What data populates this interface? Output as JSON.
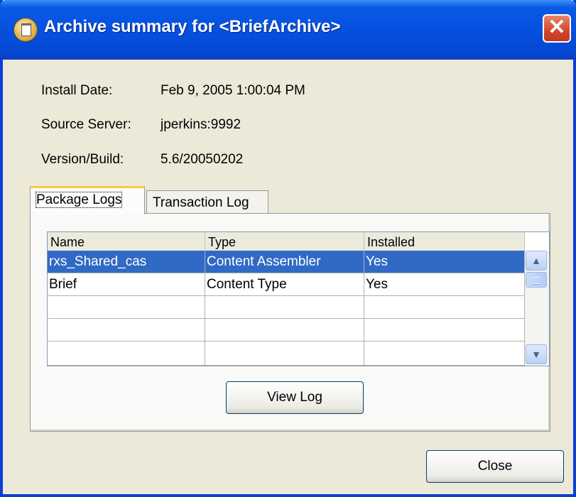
{
  "window": {
    "title": "Archive summary for <BriefArchive>"
  },
  "summary": {
    "install_date_label": "Install Date:",
    "install_date_value": "Feb 9, 2005 1:00:04 PM",
    "source_server_label": "Source Server:",
    "source_server_value": "jperkins:9992",
    "version_label": "Version/Build:",
    "version_value": "5.6/20050202"
  },
  "tabs": [
    {
      "label": "Package Logs",
      "active": true
    },
    {
      "label": "Transaction Log",
      "active": false
    }
  ],
  "table": {
    "columns": [
      "Name",
      "Type",
      "Installed"
    ],
    "rows": [
      {
        "name": "rxs_Shared_cas",
        "type": "Content Assembler",
        "installed": "Yes",
        "selected": true
      },
      {
        "name": "Brief",
        "type": "Content Type",
        "installed": "Yes",
        "selected": false
      },
      {
        "name": "",
        "type": "",
        "installed": "",
        "selected": false
      },
      {
        "name": "",
        "type": "",
        "installed": "",
        "selected": false
      },
      {
        "name": "",
        "type": "",
        "installed": "",
        "selected": false
      }
    ]
  },
  "buttons": {
    "view_log": "View Log",
    "close": "Close"
  },
  "icons": {
    "title": "archive-icon",
    "close": "close-icon",
    "scroll_up": "scroll-up-icon",
    "scroll_down": "scroll-down-icon"
  },
  "colors": {
    "titlebar": "#0650e0",
    "selection": "#316ac5",
    "tab_highlight": "#ffc83c",
    "close_button": "#d3462a"
  }
}
